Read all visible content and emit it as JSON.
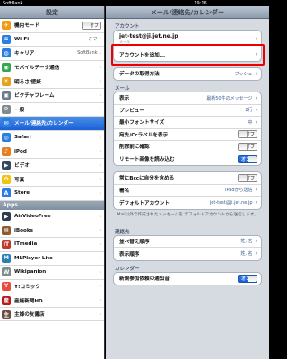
{
  "status": {
    "carrier": "SoftBank",
    "time": "19:16",
    "battery": ""
  },
  "left": {
    "title": "設定",
    "rows": [
      {
        "label": "機内モード",
        "icon_color": "#f39c12",
        "glyph": "✈",
        "toggle": "オフ"
      },
      {
        "label": "Wi-Fi",
        "icon_color": "#2a7de1",
        "glyph": "≋",
        "value": "オフ"
      },
      {
        "label": "キャリア",
        "icon_color": "#2a7de1",
        "glyph": "◍",
        "value": "SoftBank"
      },
      {
        "label": "モバイルデータ通信",
        "icon_color": "#2fa84f",
        "glyph": "◉"
      },
      {
        "label": "明るさ/壁紙",
        "icon_color": "#e6a21c",
        "glyph": "☀"
      },
      {
        "label": "ピクチャフレーム",
        "icon_color": "#6c7a89",
        "glyph": "▣"
      },
      {
        "label": "一般",
        "icon_color": "#7f8c8d",
        "glyph": "⚙"
      },
      {
        "label": "メール/連絡先/カレンダー",
        "icon_color": "#2a7de1",
        "glyph": "✉",
        "active": true
      },
      {
        "label": "Safari",
        "icon_color": "#2a7de1",
        "glyph": "◎"
      },
      {
        "label": "iPod",
        "icon_color": "#e67e22",
        "glyph": "♪"
      },
      {
        "label": "ビデオ",
        "icon_color": "#34495e",
        "glyph": "▶"
      },
      {
        "label": "写真",
        "icon_color": "#f1c40f",
        "glyph": "✿"
      },
      {
        "label": "Store",
        "icon_color": "#2a7de1",
        "glyph": "A"
      }
    ],
    "apps_section": "Apps",
    "apps": [
      {
        "label": "AirVideoFree",
        "icon_color": "#2c3e50",
        "glyph": "▶"
      },
      {
        "label": "iBooks",
        "icon_color": "#8e5a2e",
        "glyph": "▤"
      },
      {
        "label": "ITmedia",
        "icon_color": "#c0392b",
        "glyph": "IT"
      },
      {
        "label": "MLPlayer Lite",
        "icon_color": "#2980b9",
        "glyph": "M"
      },
      {
        "label": "Wikipanion",
        "icon_color": "#7f8c8d",
        "glyph": "W"
      },
      {
        "label": "Y!コミック",
        "icon_color": "#e74c3c",
        "glyph": "Y"
      },
      {
        "label": "産経新聞HD",
        "icon_color": "#b71c1c",
        "glyph": "産"
      },
      {
        "label": "主婦の友書店",
        "icon_color": "#6d4c41",
        "glyph": "主"
      }
    ]
  },
  "right": {
    "title": "メール/連絡先/カレンダー",
    "section_account": "アカウント",
    "account_email": "jet-test@ji.jet.ne.jp",
    "account_sub": "メール",
    "add_account": "アカウントを追加...",
    "fetch_label": "データの取得方法",
    "fetch_value": "プッシュ",
    "section_mail": "メール",
    "mail_rows": [
      {
        "label": "表示",
        "value": "最新50件のメッセージ"
      },
      {
        "label": "プレビュー",
        "value": "2行"
      },
      {
        "label": "最小フォントサイズ",
        "value": "中"
      },
      {
        "label": "宛先/Ccラベルを表示",
        "toggle": "オフ"
      },
      {
        "label": "削除前に確認",
        "toggle": "オフ"
      },
      {
        "label": "リモート画像を読み込む",
        "toggle_on": "オン"
      }
    ],
    "mail_rows2": [
      {
        "label": "常にBccに自分を含める",
        "toggle": "オフ"
      },
      {
        "label": "署名",
        "value": "iPadから送信"
      },
      {
        "label": "デフォルトアカウント",
        "value": "jet-test@ji.jet.ne.jp"
      }
    ],
    "note": "Mail以外で作成されたメッセージを デフォルトアカウントから送信します。",
    "section_contacts": "連絡先",
    "contact_rows": [
      {
        "label": "並べ替え順序",
        "value": "姓, 名"
      },
      {
        "label": "表示順序",
        "value": "姓, 名"
      }
    ],
    "section_calendar": "カレンダー",
    "calendar_rows": [
      {
        "label": "新規参加依頼の通知音",
        "toggle_on": "オン"
      }
    ]
  }
}
